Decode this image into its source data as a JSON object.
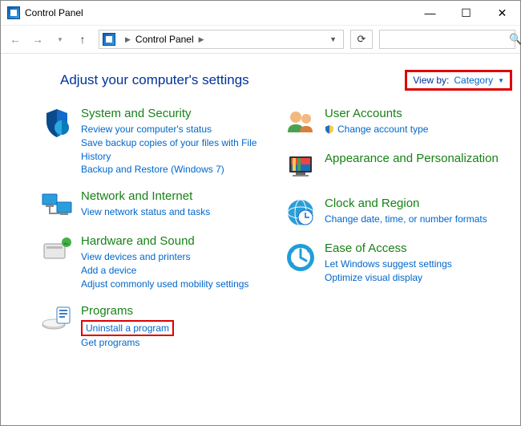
{
  "window": {
    "title": "Control Panel"
  },
  "address": {
    "crumb": "Control Panel"
  },
  "header": {
    "title": "Adjust your computer's settings",
    "viewby_label": "View by:",
    "viewby_value": "Category"
  },
  "left": [
    {
      "title": "System and Security",
      "links": [
        "Review your computer's status",
        "Save backup copies of your files with File History",
        "Backup and Restore (Windows 7)"
      ]
    },
    {
      "title": "Network and Internet",
      "links": [
        "View network status and tasks"
      ]
    },
    {
      "title": "Hardware and Sound",
      "links": [
        "View devices and printers",
        "Add a device",
        "Adjust commonly used mobility settings"
      ]
    },
    {
      "title": "Programs",
      "links": [
        "Uninstall a program",
        "Get programs"
      ]
    }
  ],
  "right": [
    {
      "title": "User Accounts",
      "links": [
        "Change account type"
      ],
      "shield": true
    },
    {
      "title": "Appearance and Personalization",
      "links": []
    },
    {
      "title": "Clock and Region",
      "links": [
        "Change date, time, or number formats"
      ]
    },
    {
      "title": "Ease of Access",
      "links": [
        "Let Windows suggest settings",
        "Optimize visual display"
      ]
    }
  ]
}
